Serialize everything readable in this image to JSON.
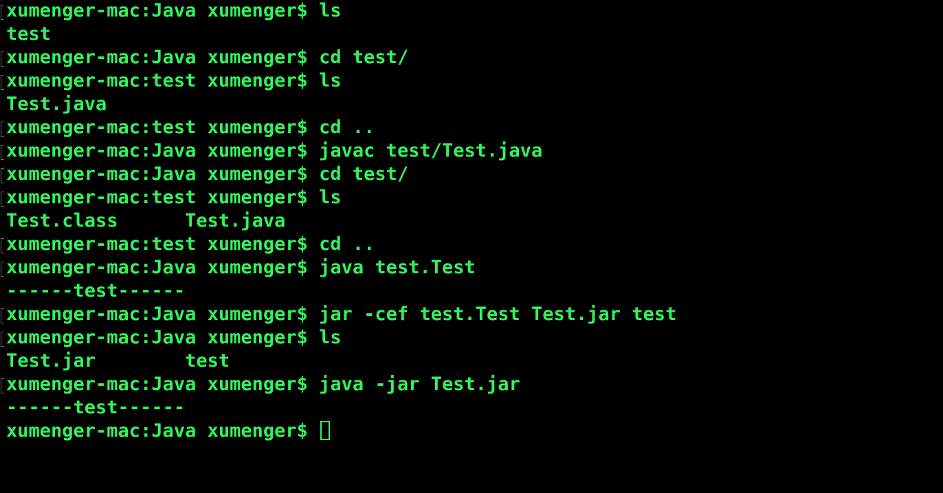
{
  "terminal": {
    "text_color": "#33f25c",
    "background_color": "#000000",
    "lines": [
      {
        "text": "xumenger-mac:Java xumenger$ ls",
        "marked": true
      },
      {
        "text": "test",
        "marked": false
      },
      {
        "text": "xumenger-mac:Java xumenger$ cd test/",
        "marked": true
      },
      {
        "text": "xumenger-mac:test xumenger$ ls",
        "marked": true
      },
      {
        "text": "Test.java",
        "marked": false
      },
      {
        "text": "xumenger-mac:test xumenger$ cd ..",
        "marked": true
      },
      {
        "text": "xumenger-mac:Java xumenger$ javac test/Test.java",
        "marked": true
      },
      {
        "text": "xumenger-mac:Java xumenger$ cd test/",
        "marked": true
      },
      {
        "text": "xumenger-mac:test xumenger$ ls",
        "marked": true
      },
      {
        "text": "Test.class      Test.java",
        "marked": false
      },
      {
        "text": "xumenger-mac:test xumenger$ cd ..",
        "marked": true
      },
      {
        "text": "xumenger-mac:Java xumenger$ java test.Test",
        "marked": true
      },
      {
        "text": "------test------",
        "marked": false
      },
      {
        "text": "xumenger-mac:Java xumenger$ jar -cef test.Test Test.jar test",
        "marked": true
      },
      {
        "text": "xumenger-mac:Java xumenger$ ls",
        "marked": true
      },
      {
        "text": "Test.jar        test",
        "marked": false
      },
      {
        "text": "xumenger-mac:Java xumenger$ java -jar Test.jar",
        "marked": true
      },
      {
        "text": "------test------",
        "marked": false
      }
    ],
    "prompt": "xumenger-mac:Java xumenger$ "
  }
}
